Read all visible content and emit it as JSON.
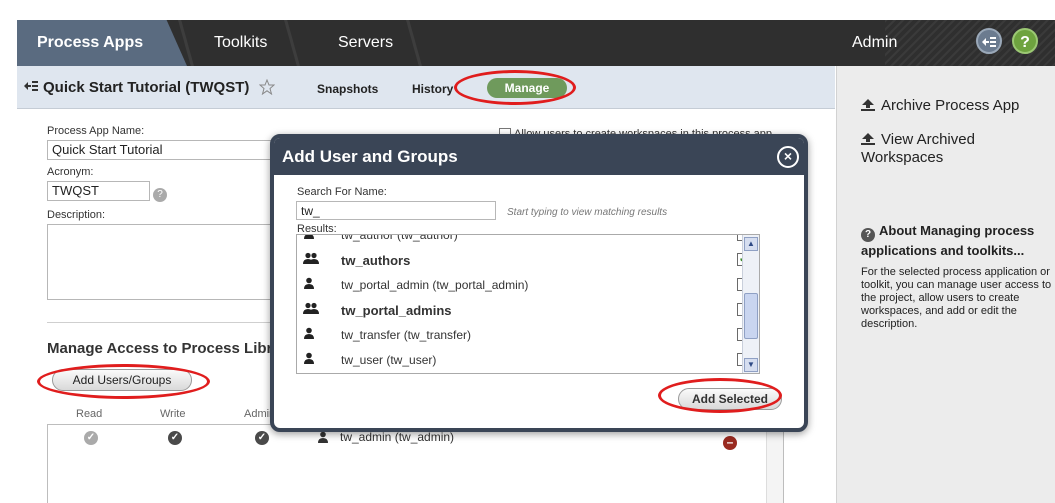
{
  "nav": {
    "tabs": [
      "Process Apps",
      "Toolkits",
      "Servers"
    ],
    "admin": "Admin",
    "help": "?"
  },
  "subheader": {
    "title": "Quick Start Tutorial (TWQST)",
    "links": [
      "Snapshots",
      "History"
    ],
    "manage": "Manage"
  },
  "form": {
    "app_name_label": "Process App Name:",
    "app_name_value": "Quick Start Tutorial",
    "acronym_label": "Acronym:",
    "acronym_value": "TWQST",
    "description_label": "Description:",
    "workspace_option": "Allow users to create workspaces in this process app",
    "section_title": "Manage Access to Process Library",
    "add_users_button": "Add Users/Groups",
    "perm_headers": [
      "Read",
      "Write",
      "Admin"
    ],
    "access_row_name": "tw_admin (tw_admin)"
  },
  "modal": {
    "title": "Add User and Groups",
    "search_label": "Search For Name:",
    "search_value": "tw_",
    "search_hint": "Start typing to view matching results",
    "results_label": "Results:",
    "partial_row": "tw_author (tw_author)",
    "results": [
      {
        "name": "tw_authors",
        "group": true,
        "checked": true
      },
      {
        "name": "tw_portal_admin (tw_portal_admin)",
        "group": false,
        "checked": false
      },
      {
        "name": "tw_portal_admins",
        "group": true,
        "checked": false
      },
      {
        "name": "tw_transfer (tw_transfer)",
        "group": false,
        "checked": false
      },
      {
        "name": "tw_user (tw_user)",
        "group": false,
        "checked": false
      }
    ],
    "add_selected_button": "Add Selected"
  },
  "rightpanel": {
    "archive_app": "Archive Process App",
    "view_archived": "View Archived Workspaces",
    "about_title": "About Managing process applications and toolkits...",
    "about_text": "For the selected process application or toolkit, you can manage user access to the project, allow users to create workspaces, and add or edit the description."
  },
  "colors": {
    "nav_bg": "#2f2f2f",
    "active_tab": "#5a6b80",
    "manage_green": "#6f9a5c",
    "highlight_red": "#e01d1d",
    "modal_header": "#3a4556"
  }
}
